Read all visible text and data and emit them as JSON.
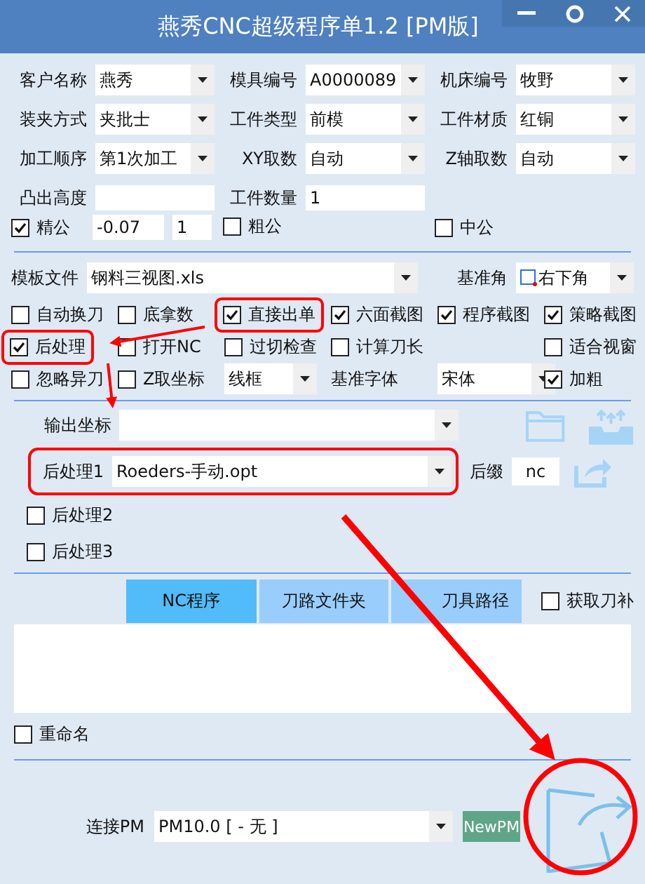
{
  "window": {
    "title": "燕秀CNC超级程序单1.2 [PM版]"
  },
  "info_rows": [
    [
      {
        "label": "客户名称",
        "value": "燕秀",
        "kind": "select"
      },
      {
        "label": "模具编号",
        "value": "A0000089",
        "kind": "select"
      },
      {
        "label": "机床编号",
        "value": "牧野",
        "kind": "select"
      }
    ],
    [
      {
        "label": "装夹方式",
        "value": "夹批士",
        "kind": "select"
      },
      {
        "label": "工件类型",
        "value": "前模",
        "kind": "select"
      },
      {
        "label": "工件材质",
        "value": "红铜",
        "kind": "select"
      }
    ],
    [
      {
        "label": "加工顺序",
        "value": "第1次加工",
        "kind": "select"
      },
      {
        "label": "XY取数",
        "value": "自动",
        "kind": "select"
      },
      {
        "label": "Z轴取数",
        "value": "自动",
        "kind": "select"
      }
    ],
    [
      {
        "label": "凸出高度",
        "kind": "input"
      },
      {
        "label": "工件数量",
        "value": "1",
        "kind": "input"
      }
    ]
  ],
  "tolerance": {
    "fine": {
      "label": "精公",
      "checked": true
    },
    "fine_values": [
      "-0.07",
      "1"
    ],
    "rough": {
      "label": "粗公",
      "checked": false
    },
    "medium": {
      "label": "中公",
      "checked": false
    }
  },
  "template": {
    "label": "模板文件",
    "value": "钢料三视图.xls",
    "datum_label": "基准角",
    "datum_value": "右下角"
  },
  "options": [
    [
      {
        "kind": "checkbox",
        "label": "自动换刀",
        "checked": false,
        "highlighted": false
      },
      {
        "kind": "checkbox",
        "label": "底拿数",
        "checked": false,
        "highlighted": false
      },
      {
        "kind": "checkbox",
        "label": "直接出单",
        "checked": true,
        "highlighted": true
      },
      {
        "kind": "checkbox",
        "label": "六面截图",
        "checked": true,
        "highlighted": false
      },
      {
        "kind": "checkbox",
        "label": "程序截图",
        "checked": true,
        "highlighted": false
      },
      {
        "kind": "checkbox",
        "label": "策略截图",
        "checked": true,
        "highlighted": false
      }
    ],
    [
      {
        "kind": "checkbox",
        "label": "后处理",
        "checked": true,
        "highlighted": true
      },
      {
        "kind": "checkbox",
        "label": "打开NC",
        "checked": false,
        "highlighted": false
      },
      {
        "kind": "checkbox",
        "label": "过切检查",
        "checked": false,
        "highlighted": false
      },
      {
        "kind": "checkbox",
        "label": "计算刀长",
        "checked": false,
        "highlighted": false
      },
      {
        "kind": "spacer"
      },
      {
        "kind": "checkbox",
        "label": "适合视窗",
        "checked": false,
        "highlighted": false
      }
    ],
    [
      {
        "kind": "checkbox",
        "label": "忽略异刀",
        "checked": false,
        "highlighted": false
      },
      {
        "kind": "checkbox",
        "label": "Z取坐标",
        "checked": false,
        "highlighted": false
      },
      {
        "kind": "select",
        "value": "线框"
      },
      {
        "kind": "label",
        "label": "基准字体"
      },
      {
        "kind": "select",
        "value": "宋体"
      },
      {
        "kind": "checkbox",
        "label": "加粗",
        "checked": true,
        "highlighted": false
      }
    ]
  ],
  "output": {
    "label": "输出坐标"
  },
  "post_processor": {
    "label": "后处理1",
    "value": "Roeders-手动.opt",
    "suffix_label": "后缀",
    "suffix_value": "nc",
    "highlighted": true
  },
  "extra_post": [
    {
      "label": "后处理2",
      "checked": false
    },
    {
      "label": "后处理3",
      "checked": false
    }
  ],
  "tabs": [
    {
      "label": "NC程序",
      "selected": true
    },
    {
      "label": "刀路文件夹",
      "selected": false
    },
    {
      "label": "刀具路径",
      "selected": false
    }
  ],
  "get_tool_comp": {
    "label": "获取刀补",
    "checked": false
  },
  "rename": {
    "label": "重命名",
    "checked": false
  },
  "connect": {
    "label": "连接PM",
    "value": "PM10.0 [ - 无 ]",
    "button": "NewPM"
  }
}
